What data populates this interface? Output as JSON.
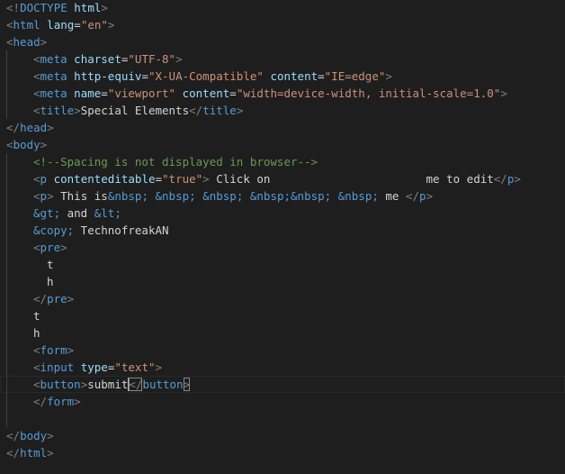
{
  "editor": {
    "language": "html",
    "lines": [
      {
        "indent": 0,
        "tokens": [
          {
            "c": "ang",
            "t": "<!"
          },
          {
            "c": "tag",
            "t": "DOCTYPE"
          },
          {
            "c": "text",
            "t": " "
          },
          {
            "c": "attr",
            "t": "html"
          },
          {
            "c": "ang",
            "t": ">"
          }
        ]
      },
      {
        "indent": 0,
        "tokens": [
          {
            "c": "ang",
            "t": "<"
          },
          {
            "c": "tag",
            "t": "html"
          },
          {
            "c": "text",
            "t": " "
          },
          {
            "c": "attr",
            "t": "lang"
          },
          {
            "c": "eq",
            "t": "="
          },
          {
            "c": "str",
            "t": "\"en\""
          },
          {
            "c": "ang",
            "t": ">"
          }
        ]
      },
      {
        "indent": 0,
        "tokens": [
          {
            "c": "ang",
            "t": "<"
          },
          {
            "c": "tag",
            "t": "head"
          },
          {
            "c": "ang",
            "t": ">"
          }
        ]
      },
      {
        "indent": 1,
        "tokens": [
          {
            "c": "ang",
            "t": "<"
          },
          {
            "c": "tag",
            "t": "meta"
          },
          {
            "c": "text",
            "t": " "
          },
          {
            "c": "attr",
            "t": "charset"
          },
          {
            "c": "eq",
            "t": "="
          },
          {
            "c": "str",
            "t": "\"UTF-8\""
          },
          {
            "c": "ang",
            "t": ">"
          }
        ]
      },
      {
        "indent": 1,
        "tokens": [
          {
            "c": "ang",
            "t": "<"
          },
          {
            "c": "tag",
            "t": "meta"
          },
          {
            "c": "text",
            "t": " "
          },
          {
            "c": "attr",
            "t": "http-equiv"
          },
          {
            "c": "eq",
            "t": "="
          },
          {
            "c": "str",
            "t": "\"X-UA-Compatible\""
          },
          {
            "c": "text",
            "t": " "
          },
          {
            "c": "attr",
            "t": "content"
          },
          {
            "c": "eq",
            "t": "="
          },
          {
            "c": "str",
            "t": "\"IE=edge\""
          },
          {
            "c": "ang",
            "t": ">"
          }
        ]
      },
      {
        "indent": 1,
        "tokens": [
          {
            "c": "ang",
            "t": "<"
          },
          {
            "c": "tag",
            "t": "meta"
          },
          {
            "c": "text",
            "t": " "
          },
          {
            "c": "attr",
            "t": "name"
          },
          {
            "c": "eq",
            "t": "="
          },
          {
            "c": "str",
            "t": "\"viewport\""
          },
          {
            "c": "text",
            "t": " "
          },
          {
            "c": "attr",
            "t": "content"
          },
          {
            "c": "eq",
            "t": "="
          },
          {
            "c": "str",
            "t": "\"width=device-width, initial-scale=1.0\""
          },
          {
            "c": "ang",
            "t": ">"
          }
        ]
      },
      {
        "indent": 1,
        "tokens": [
          {
            "c": "ang",
            "t": "<"
          },
          {
            "c": "tag",
            "t": "title"
          },
          {
            "c": "ang",
            "t": ">"
          },
          {
            "c": "text",
            "t": "Special Elements"
          },
          {
            "c": "ang",
            "t": "</"
          },
          {
            "c": "tag",
            "t": "title"
          },
          {
            "c": "ang",
            "t": ">"
          }
        ]
      },
      {
        "indent": 0,
        "tokens": [
          {
            "c": "ang",
            "t": "</"
          },
          {
            "c": "tag",
            "t": "head"
          },
          {
            "c": "ang",
            "t": ">"
          }
        ]
      },
      {
        "indent": 0,
        "tokens": [
          {
            "c": "ang",
            "t": "<"
          },
          {
            "c": "tag",
            "t": "body"
          },
          {
            "c": "ang",
            "t": ">"
          }
        ]
      },
      {
        "indent": 1,
        "tokens": [
          {
            "c": "cmt",
            "t": "<!--Spacing is not displayed in browser-->"
          }
        ]
      },
      {
        "indent": 1,
        "tokens": [
          {
            "c": "ang",
            "t": "<"
          },
          {
            "c": "tag",
            "t": "p"
          },
          {
            "c": "text",
            "t": " "
          },
          {
            "c": "attr",
            "t": "contenteditable"
          },
          {
            "c": "eq",
            "t": "="
          },
          {
            "c": "str",
            "t": "\"true\""
          },
          {
            "c": "ang",
            "t": ">"
          },
          {
            "c": "text",
            "t": " Click on                       me to edit"
          },
          {
            "c": "ang",
            "t": "</"
          },
          {
            "c": "tag",
            "t": "p"
          },
          {
            "c": "ang",
            "t": ">"
          }
        ]
      },
      {
        "indent": 1,
        "tokens": [
          {
            "c": "ang",
            "t": "<"
          },
          {
            "c": "tag",
            "t": "p"
          },
          {
            "c": "ang",
            "t": ">"
          },
          {
            "c": "text",
            "t": " This is"
          },
          {
            "c": "ent",
            "t": "&nbsp;"
          },
          {
            "c": "text",
            "t": " "
          },
          {
            "c": "ent",
            "t": "&nbsp;"
          },
          {
            "c": "text",
            "t": " "
          },
          {
            "c": "ent",
            "t": "&nbsp;"
          },
          {
            "c": "text",
            "t": " "
          },
          {
            "c": "ent",
            "t": "&nbsp;&nbsp;"
          },
          {
            "c": "text",
            "t": " "
          },
          {
            "c": "ent",
            "t": "&nbsp;"
          },
          {
            "c": "text",
            "t": " me "
          },
          {
            "c": "ang",
            "t": "</"
          },
          {
            "c": "tag",
            "t": "p"
          },
          {
            "c": "ang",
            "t": ">"
          }
        ]
      },
      {
        "indent": 1,
        "tokens": [
          {
            "c": "ent",
            "t": "&gt;"
          },
          {
            "c": "text",
            "t": " and "
          },
          {
            "c": "ent",
            "t": "&lt;"
          }
        ]
      },
      {
        "indent": 1,
        "tokens": [
          {
            "c": "ent",
            "t": "&copy;"
          },
          {
            "c": "text",
            "t": " TechnofreakAN"
          }
        ]
      },
      {
        "indent": 1,
        "tokens": [
          {
            "c": "ang",
            "t": "<"
          },
          {
            "c": "tag",
            "t": "pre"
          },
          {
            "c": "ang",
            "t": ">"
          }
        ]
      },
      {
        "indent": 1,
        "tokens": [
          {
            "c": "text",
            "t": "  t"
          }
        ]
      },
      {
        "indent": 1,
        "tokens": [
          {
            "c": "text",
            "t": "  h"
          }
        ]
      },
      {
        "indent": 1,
        "tokens": [
          {
            "c": "ang",
            "t": "</"
          },
          {
            "c": "tag",
            "t": "pre"
          },
          {
            "c": "ang",
            "t": ">"
          }
        ]
      },
      {
        "indent": 1,
        "tokens": [
          {
            "c": "text",
            "t": "t"
          }
        ]
      },
      {
        "indent": 1,
        "tokens": [
          {
            "c": "text",
            "t": "h"
          }
        ]
      },
      {
        "indent": 1,
        "tokens": [
          {
            "c": "ang",
            "t": "<"
          },
          {
            "c": "tag",
            "t": "form"
          },
          {
            "c": "ang",
            "t": ">"
          }
        ]
      },
      {
        "indent": 1,
        "tokens": [
          {
            "c": "ang",
            "t": "<"
          },
          {
            "c": "tag",
            "t": "input"
          },
          {
            "c": "text",
            "t": " "
          },
          {
            "c": "attr",
            "t": "type"
          },
          {
            "c": "eq",
            "t": "="
          },
          {
            "c": "str",
            "t": "\"text\""
          },
          {
            "c": "ang",
            "t": ">"
          }
        ]
      },
      {
        "indent": 1,
        "active": true,
        "tokens": [
          {
            "c": "ang",
            "t": "<"
          },
          {
            "c": "tag",
            "t": "button"
          },
          {
            "c": "ang",
            "t": ">"
          },
          {
            "c": "text",
            "t": "submit"
          },
          {
            "c": "cursor",
            "t": ""
          },
          {
            "c": "ang",
            "t": "</",
            "hl": true
          },
          {
            "c": "tag",
            "t": "button"
          },
          {
            "c": "ang",
            "t": ">",
            "hl": true
          }
        ]
      },
      {
        "indent": 1,
        "tokens": [
          {
            "c": "ang",
            "t": "</"
          },
          {
            "c": "tag",
            "t": "form"
          },
          {
            "c": "ang",
            "t": ">"
          }
        ]
      },
      {
        "indent": 1,
        "tokens": []
      },
      {
        "indent": 0,
        "tokens": [
          {
            "c": "ang",
            "t": "</"
          },
          {
            "c": "tag",
            "t": "body"
          },
          {
            "c": "ang",
            "t": ">"
          }
        ]
      },
      {
        "indent": 0,
        "tokens": [
          {
            "c": "ang",
            "t": "</"
          },
          {
            "c": "tag",
            "t": "html"
          },
          {
            "c": "ang",
            "t": ">"
          }
        ]
      }
    ]
  },
  "colors": {
    "background": "#1e1e1e",
    "tag": "#569cd6",
    "angle_bracket": "#808080",
    "attribute": "#9cdcfe",
    "string": "#ce9178",
    "text": "#d4d4d4",
    "comment": "#6a9955"
  }
}
